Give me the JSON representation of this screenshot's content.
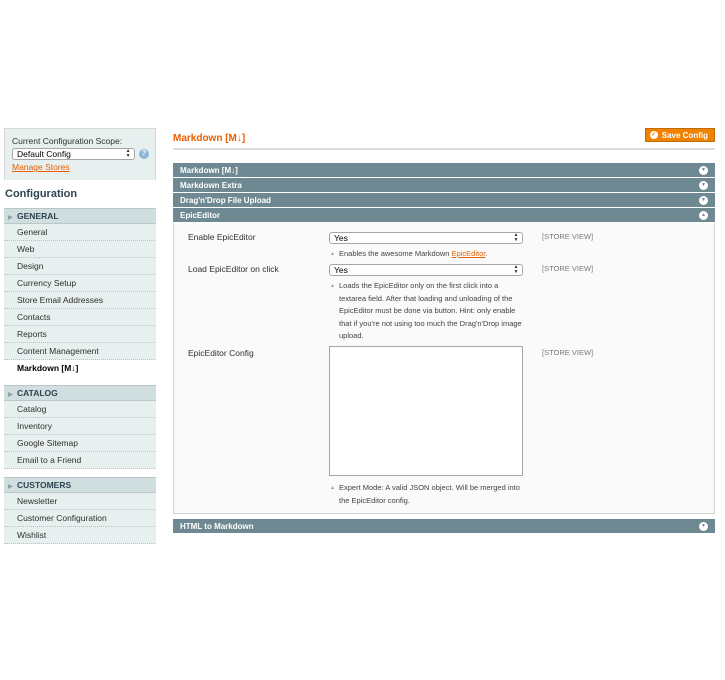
{
  "sidebar": {
    "scope_label": "Current Configuration Scope:",
    "scope_value": "Default Config",
    "help_icon": "?",
    "manage_stores": "Manage Stores",
    "title": "Configuration",
    "groups": [
      {
        "title": "GENERAL",
        "items": [
          "General",
          "Web",
          "Design",
          "Currency Setup",
          "Store Email Addresses",
          "Contacts",
          "Reports",
          "Content Management",
          "Markdown [M↓]"
        ]
      },
      {
        "title": "CATALOG",
        "items": [
          "Catalog",
          "Inventory",
          "Google Sitemap",
          "Email to a Friend"
        ]
      },
      {
        "title": "CUSTOMERS",
        "items": [
          "Newsletter",
          "Customer Configuration",
          "Wishlist"
        ]
      }
    ],
    "active_item": "Markdown [M↓]"
  },
  "main": {
    "title": "Markdown [M↓]",
    "save_label": "Save Config",
    "save_icon": "check-circle-icon",
    "sections": [
      {
        "title": "Markdown [M↓]",
        "state": "collapsed"
      },
      {
        "title": "Markdown Extra",
        "state": "collapsed"
      },
      {
        "title": "Drag'n'Drop File Upload",
        "state": "collapsed"
      },
      {
        "title": "EpicEditor",
        "state": "expanded"
      }
    ],
    "epic": {
      "enable": {
        "label": "Enable EpicEditor",
        "value": "Yes",
        "scope": "[STORE VIEW]",
        "note_prefix": "Enables the awesome Markdown ",
        "note_link": "EpicEditor",
        "note_suffix": "."
      },
      "load": {
        "label": "Load EpicEditor on click",
        "value": "Yes",
        "scope": "[STORE VIEW]",
        "note_lines": [
          "Loads the EpicEditor only on the first click into a",
          "textarea field. After that loading and unloading of the",
          "EpicEditor must be done via button. Hint: only enable",
          "that if you're not using too much the Drag'n'Drop image",
          "upload."
        ]
      },
      "config": {
        "label": "EpicEditor Config",
        "value": "",
        "scope": "[STORE VIEW]",
        "note_lines": [
          "Expert Mode: A valid JSON object. Will be merged into",
          "the EpicEditor config."
        ]
      }
    },
    "bottom_section": {
      "title": "HTML to Markdown",
      "state": "collapsed"
    }
  },
  "colors": {
    "accent": "#eb5e00",
    "button": "#f18200",
    "section_header": "#6f8992",
    "sidebar_bg": "#e7efef",
    "group_bg": "#d1dedf"
  }
}
